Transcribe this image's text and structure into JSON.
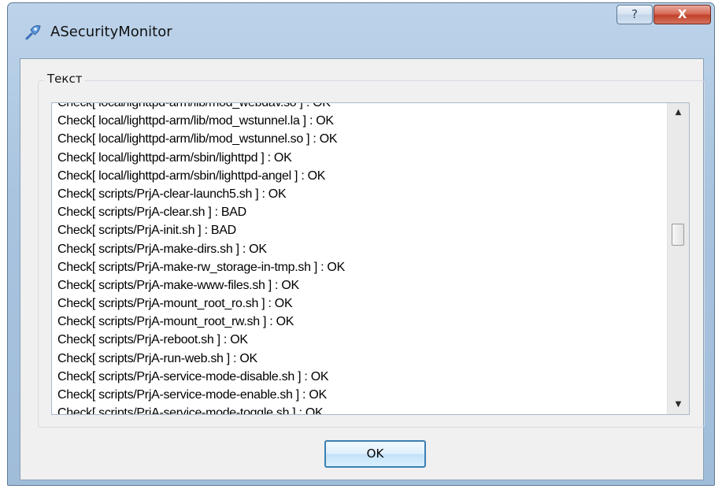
{
  "window": {
    "title": "ASecurityMonitor",
    "help_label": "?",
    "close_label": "X"
  },
  "group": {
    "label": "Текст"
  },
  "log": {
    "lines": [
      "Check[ local/lighttpd-arm/lib/mod_webdav.so ] : OK",
      "Check[ local/lighttpd-arm/lib/mod_wstunnel.la ] : OK",
      "Check[ local/lighttpd-arm/lib/mod_wstunnel.so ] : OK",
      "Check[ local/lighttpd-arm/sbin/lighttpd ] : OK",
      "Check[ local/lighttpd-arm/sbin/lighttpd-angel ] : OK",
      "Check[ scripts/PrjA-clear-launch5.sh ] : OK",
      "Check[ scripts/PrjA-clear.sh ] : BAD",
      "Check[ scripts/PrjA-init.sh ] : BAD",
      "Check[ scripts/PrjA-make-dirs.sh ] : OK",
      "Check[ scripts/PrjA-make-rw_storage-in-tmp.sh ] : OK",
      "Check[ scripts/PrjA-make-www-files.sh ] : OK",
      "Check[ scripts/PrjA-mount_root_ro.sh ] : OK",
      "Check[ scripts/PrjA-mount_root_rw.sh ] : OK",
      "Check[ scripts/PrjA-reboot.sh ] : OK",
      "Check[ scripts/PrjA-run-web.sh ] : OK",
      "Check[ scripts/PrjA-service-mode-disable.sh ] : OK",
      "Check[ scripts/PrjA-service-mode-enable.sh ] : OK",
      "Check[ scripts/PrjA-service-mode-toggle.sh ] : OK"
    ]
  },
  "scroll": {
    "up_icon": "triangle-up-icon",
    "down_icon": "triangle-down-icon"
  },
  "buttons": {
    "ok_label": "OK"
  },
  "colors": {
    "title_bar": "#a9c4df",
    "close_button": "#c0412a",
    "dialog_background": "#f0f0f0",
    "ok_border": "#3c7fb1"
  }
}
